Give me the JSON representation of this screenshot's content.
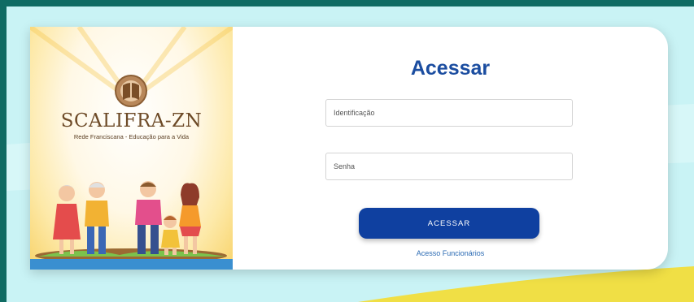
{
  "brand": {
    "name": "SCALIFRA-ZN",
    "tagline": "Rede Franciscana - Educação para a Vida"
  },
  "login": {
    "title": "Acessar",
    "identification_placeholder": "Identificação",
    "password_placeholder": "Senha",
    "submit_label": "ACESSAR",
    "staff_link": "Acesso Funcionários"
  },
  "colors": {
    "page_border": "#0f6b63",
    "background": "#c9f3f5",
    "title": "#1b4da0",
    "button": "#0f40a0",
    "link": "#2a6ab3",
    "accent_yellow": "#f0df45"
  }
}
